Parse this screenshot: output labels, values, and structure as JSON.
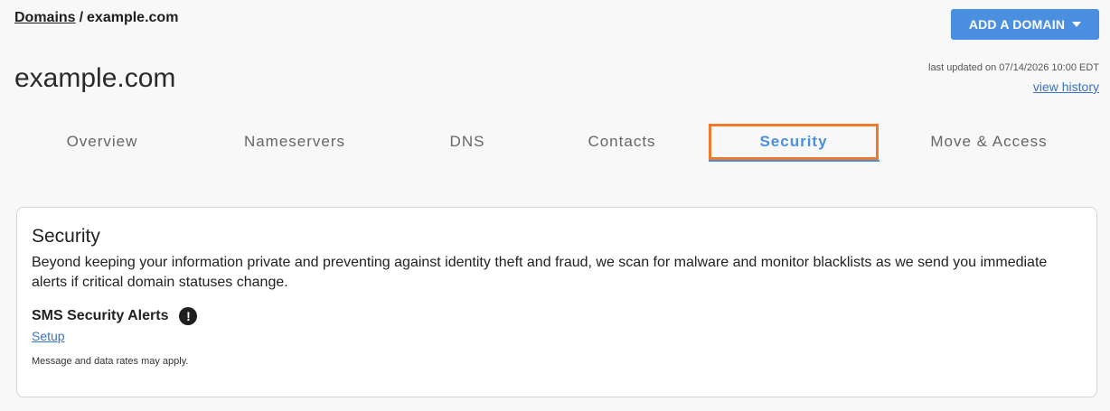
{
  "breadcrumb": {
    "root_label": "Domains",
    "separator": "/",
    "current": "example.com"
  },
  "header": {
    "add_domain_label": "ADD A DOMAIN",
    "title": "example.com",
    "last_updated": "last updated on 07/14/2026 10:00 EDT",
    "view_history_label": "view history"
  },
  "tabs": [
    {
      "label": "Overview"
    },
    {
      "label": "Nameservers"
    },
    {
      "label": "DNS"
    },
    {
      "label": "Contacts"
    },
    {
      "label": "Security",
      "active": true
    },
    {
      "label": "Move & Access"
    }
  ],
  "security": {
    "title": "Security",
    "description": "Beyond keeping your information private and preventing against identity theft and fraud, we scan for malware and monitor blacklists as we send you immediate alerts if critical domain statuses change.",
    "sms_title": "SMS Security Alerts",
    "alert_glyph": "!",
    "setup_label": "Setup",
    "note": "Message and data rates may apply."
  },
  "colors": {
    "accent": "#4a8fe0",
    "highlight": "#f07a2b",
    "link": "#3a72c4"
  }
}
